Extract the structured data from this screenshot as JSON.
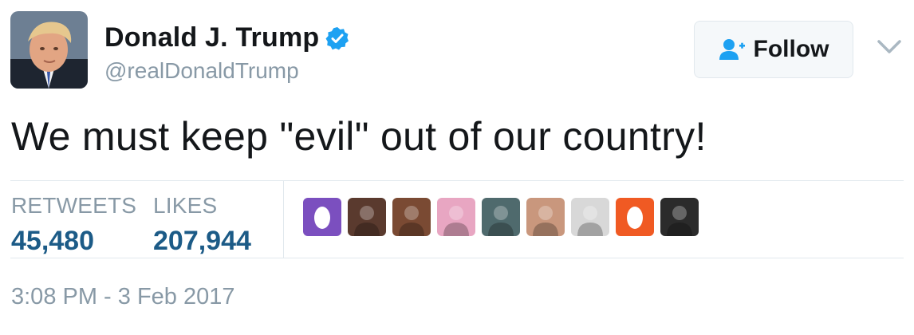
{
  "user": {
    "display_name": "Donald J. Trump",
    "handle": "@realDonaldTrump",
    "verified": true
  },
  "follow_button": {
    "label": "Follow"
  },
  "tweet": {
    "text": "We must keep \"evil\" out of our country!"
  },
  "stats": {
    "retweets_label": "RETWEETS",
    "retweets_count": "45,480",
    "likes_label": "LIKES",
    "likes_count": "207,944"
  },
  "likers": [
    {
      "icon": "egg-avatar",
      "color": "#7b4fbf"
    },
    {
      "icon": "photo-avatar",
      "color": "#5a3a2e"
    },
    {
      "icon": "photo-avatar",
      "color": "#7a4a33"
    },
    {
      "icon": "photo-avatar",
      "color": "#e8a6c2"
    },
    {
      "icon": "photo-avatar",
      "color": "#4f6a6d"
    },
    {
      "icon": "photo-avatar",
      "color": "#c9977d"
    },
    {
      "icon": "photo-avatar",
      "color": "#d8d8d8"
    },
    {
      "icon": "egg-avatar",
      "color": "#f05a23"
    },
    {
      "icon": "photo-avatar",
      "color": "#2b2b2b"
    }
  ],
  "timestamp": "3:08 PM - 3 Feb 2017",
  "colors": {
    "verified_blue": "#1da1f2",
    "stat_blue": "#1c5b87",
    "muted_gray": "#8899a6"
  }
}
